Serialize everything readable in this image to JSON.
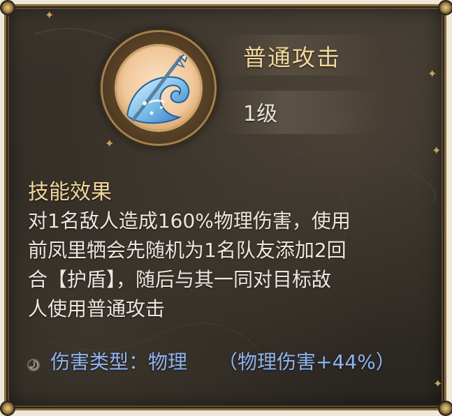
{
  "skill": {
    "name": "普通攻击",
    "level": "1级",
    "icon": "water-wave-spear-icon"
  },
  "effect": {
    "title": "技能效果",
    "lines": [
      "对1名敌人造成160%物理伤害，使用",
      "前凤里牺会先随机为1名队友添加2回",
      "合【护盾】，随后与其一同对目标敌",
      "人使用普通攻击"
    ]
  },
  "damage": {
    "type_label": "伤害类型：物理",
    "bonus": "（物理伤害+44%）",
    "icon": "swirl-icon"
  },
  "colors": {
    "gold_title": "#f2d699",
    "blue_text": "#8fb4f2",
    "frame_gold": "#8a6d3f",
    "panel_bg": "#2f2a24"
  }
}
